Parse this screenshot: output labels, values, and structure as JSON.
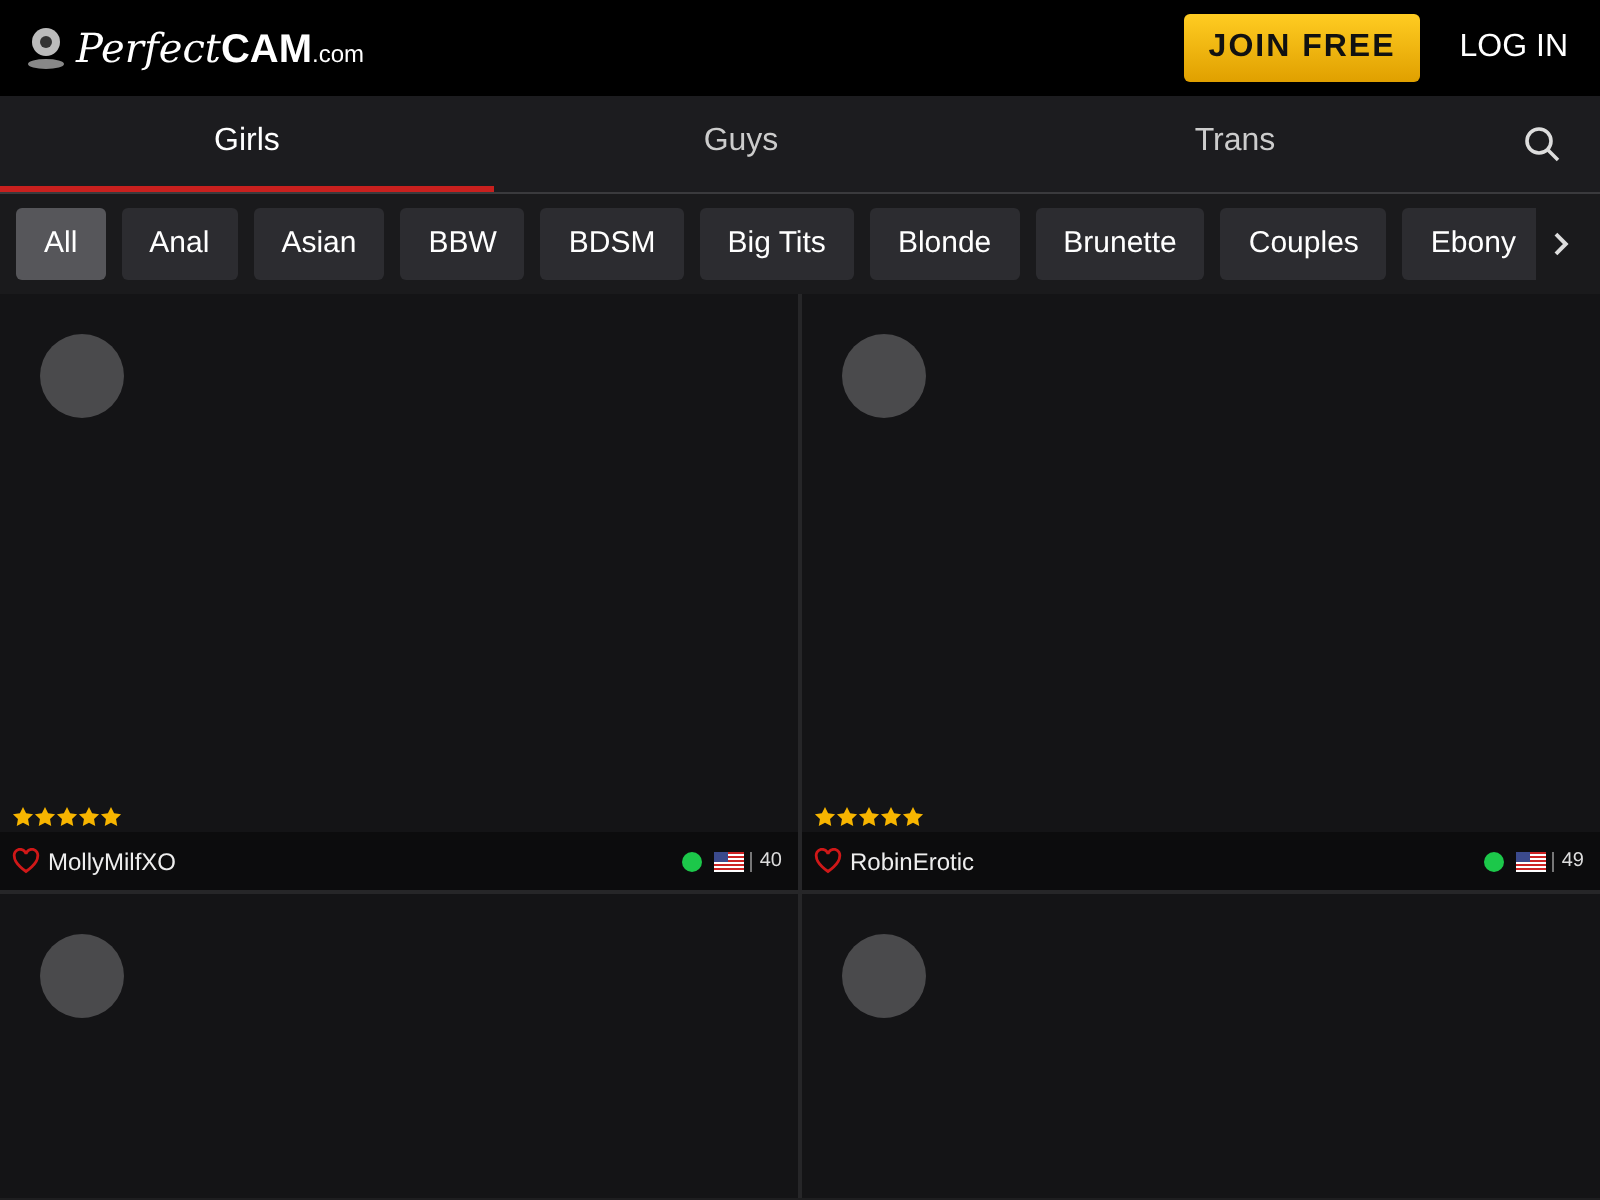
{
  "logo": {
    "script": "Perfect",
    "bold": "CAM",
    "suffix": ".com"
  },
  "header_buttons": [
    {
      "label": "JOIN FREE",
      "kind": "primary"
    },
    {
      "label": "LOG IN",
      "kind": "link"
    }
  ],
  "tabs": [
    {
      "label": "Girls",
      "selected": true
    },
    {
      "label": "Guys",
      "selected": false
    },
    {
      "label": "Trans",
      "selected": false
    }
  ],
  "categories": [
    {
      "label": "All",
      "selected": true
    },
    {
      "label": "Anal",
      "selected": false
    },
    {
      "label": "Asian",
      "selected": false
    },
    {
      "label": "BBW",
      "selected": false
    },
    {
      "label": "BDSM",
      "selected": false
    },
    {
      "label": "Big Tits",
      "selected": false
    },
    {
      "label": "Blonde",
      "selected": false
    },
    {
      "label": "Brunette",
      "selected": false
    },
    {
      "label": "Couples",
      "selected": false
    },
    {
      "label": "Ebony",
      "selected": false
    }
  ],
  "cams": [
    {
      "kind": "full",
      "name": "MollyMilfXO",
      "stars": 5,
      "online": true,
      "favorite": false,
      "viewers": "40"
    },
    {
      "kind": "full",
      "name": "RobinErotic",
      "stars": 5,
      "online": true,
      "favorite": false,
      "viewers": "49"
    },
    {
      "kind": "cut"
    },
    {
      "kind": "cut"
    }
  ]
}
